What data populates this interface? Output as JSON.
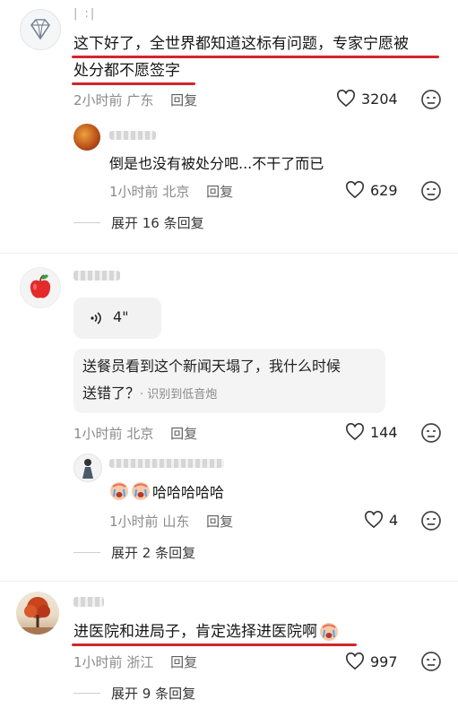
{
  "comments": [
    {
      "username": "| :|",
      "text_line1": "这下好了，全世界都知道这标有问题，专家宁愿被",
      "text_line2": "处分都不愿签字",
      "time": "2小时前",
      "location": "广东",
      "reply_label": "回复",
      "likes": "3204",
      "replies": [
        {
          "text": "倒是也没有被处分吧...不干了而已",
          "time": "1小时前",
          "location": "北京",
          "reply_label": "回复",
          "likes": "629"
        }
      ],
      "expand_label": "展开 16 条回复"
    },
    {
      "voice_duration": "4\"",
      "quote_line1": "送餐员看到这个新闻天塌了，我什么时候",
      "quote_line2": "送错了？",
      "quote_source": "· 识别到低音炮",
      "time": "1小时前",
      "location": "北京",
      "reply_label": "回复",
      "likes": "144",
      "replies": [
        {
          "text": "哈哈哈哈哈",
          "time": "1小时前",
          "location": "山东",
          "reply_label": "回复",
          "likes": "4"
        }
      ],
      "expand_label": "展开 2 条回复"
    },
    {
      "text": "进医院和进局子，肯定选择进医院啊",
      "time": "1小时前",
      "location": "浙江",
      "reply_label": "回复",
      "likes": "997",
      "expand_label": "展开 9 条回复"
    }
  ],
  "colors": {
    "highlight_underline": "#d0262b",
    "meta_gray": "#8a8a8a"
  },
  "icons": [
    "diamond-avatar",
    "apple-avatar",
    "heart-icon",
    "dislike-face-icon",
    "crying-emoji",
    "voice-wave-icon"
  ]
}
